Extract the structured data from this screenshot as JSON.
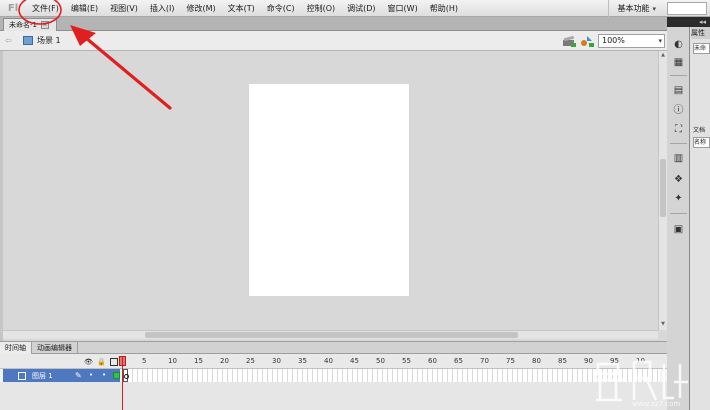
{
  "menubar": {
    "logo": "Fl",
    "items": [
      "文件(F)",
      "编辑(E)",
      "视图(V)",
      "插入(I)",
      "修改(M)",
      "文本(T)",
      "命令(C)",
      "控制(O)",
      "调试(D)",
      "窗口(W)",
      "帮助(H)"
    ],
    "workspace": "基本功能"
  },
  "document": {
    "tab_label": "未命名-1",
    "scene_label": "场景 1",
    "zoom_value": "100%"
  },
  "timeline": {
    "tabs": [
      "时间轴",
      "动画编辑器"
    ],
    "frame_ticks": [
      "5",
      "10",
      "15",
      "20",
      "25",
      "30",
      "35",
      "40",
      "45",
      "50",
      "55",
      "60",
      "65",
      "70",
      "75",
      "80",
      "85",
      "90",
      "95",
      "10"
    ],
    "layer_name": "图层 1"
  },
  "right_panel": {
    "collapse_label": "◂◂",
    "props_tab": "属性",
    "field_1": "未命",
    "label_1": "文档",
    "field_2": "名称"
  },
  "annotations": {
    "highlight_color": "#e02020"
  },
  "watermark": {
    "url": "www.xz7.com"
  }
}
